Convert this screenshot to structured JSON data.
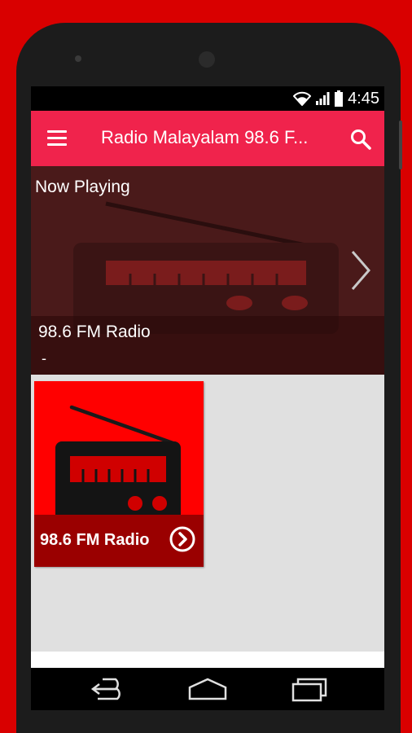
{
  "status_bar": {
    "time": "4:45",
    "icons": [
      "wifi-icon",
      "signal-icon",
      "battery-icon"
    ]
  },
  "app_bar": {
    "title": "Radio Malayalam 98.6 F...",
    "icons": [
      "menu-icon",
      "search-icon"
    ]
  },
  "now_playing": {
    "label": "Now Playing",
    "station": "98.6 FM Radio",
    "track": "-"
  },
  "stations": [
    {
      "title": "98.6 FM Radio"
    }
  ],
  "nav_bar": {
    "icons": [
      "back-icon",
      "home-icon",
      "recents-icon"
    ]
  },
  "colors": {
    "frame": "#d90000",
    "app_bar": "#f0234c",
    "now_playing_bg": "#4a1a1a",
    "card": "#ff0000",
    "card_footer": "#9a0000",
    "list_bg": "#e0e0e0"
  }
}
